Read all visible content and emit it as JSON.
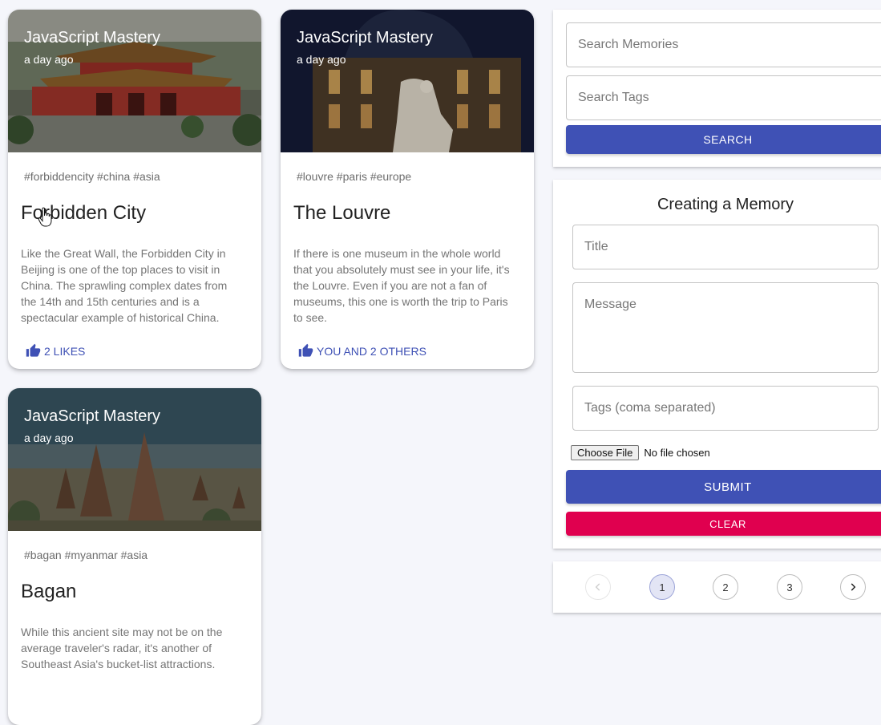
{
  "posts": [
    {
      "author": "JavaScript Mastery",
      "time": "a day ago",
      "tags": "#forbiddencity #china #asia",
      "title": "Forbidden City",
      "message": "Like the Great Wall, the Forbidden City in Beijing is one of the top places to visit in China. The sprawling complex dates from the 14th and 15th centuries and is a spectacular example of historical China.",
      "likes": "2 LIKES"
    },
    {
      "author": "JavaScript Mastery",
      "time": "a day ago",
      "tags": "#louvre #paris #europe",
      "title": "The Louvre",
      "message": "If there is one museum in the whole world that you absolutely must see in your life, it's the Louvre. Even if you are not a fan of museums, this one is worth the trip to Paris to see.",
      "likes": "YOU AND 2 OTHERS"
    },
    {
      "author": "JavaScript Mastery",
      "time": "a day ago",
      "tags": "#bagan #myanmar #asia",
      "title": "Bagan",
      "message": "While this ancient site may not be on the average traveler's radar, it's another of Southeast Asia's bucket-list attractions."
    }
  ],
  "search": {
    "memories_placeholder": "Search Memories",
    "tags_placeholder": "Search Tags",
    "button_label": "SEARCH"
  },
  "form": {
    "heading": "Creating a Memory",
    "title_placeholder": "Title",
    "message_placeholder": "Message",
    "tags_placeholder": "Tags (coma separated)",
    "choose_file_label": "Choose File",
    "no_file_label": "No file chosen",
    "submit_label": "SUBMIT",
    "clear_label": "CLEAR"
  },
  "pagination": {
    "pages": [
      "1",
      "2",
      "3"
    ],
    "current_page": "1"
  },
  "colors": {
    "primary": "#3f51b5",
    "secondary": "#e0004f",
    "background": "#f5f6fb"
  },
  "icons": {
    "like": "thumb-up-icon",
    "prev": "chevron-left-icon",
    "next": "chevron-right-icon",
    "cursor": "hand-pointer-icon"
  }
}
